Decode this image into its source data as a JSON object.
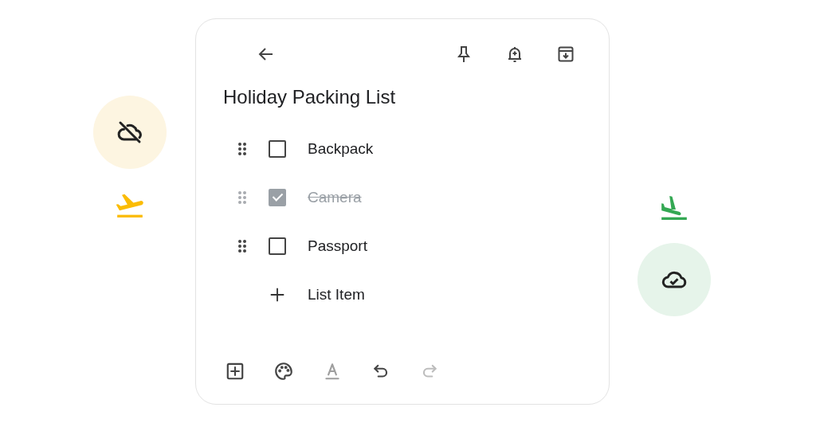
{
  "note": {
    "title": "Holiday Packing List",
    "items": [
      {
        "label": "Backpack",
        "checked": false
      },
      {
        "label": "Camera",
        "checked": true
      },
      {
        "label": "Passport",
        "checked": false
      }
    ],
    "add_item": {
      "label": "List Item"
    },
    "toolbar": [
      {
        "kind": "add",
        "disabled": false
      },
      {
        "kind": "palette",
        "disabled": false
      },
      {
        "kind": "format",
        "disabled": true
      },
      {
        "kind": "undo",
        "disabled": false
      },
      {
        "kind": "redo",
        "disabled": true
      }
    ]
  }
}
